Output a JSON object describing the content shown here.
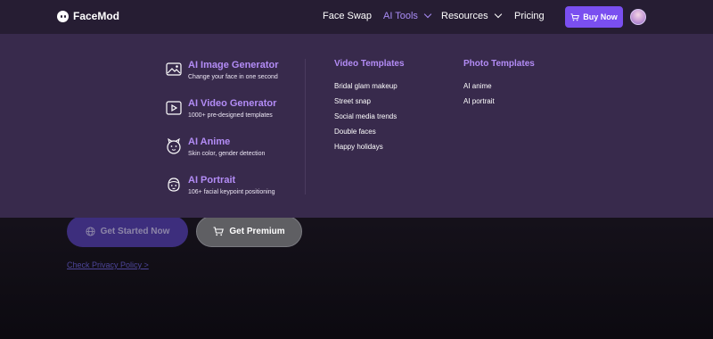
{
  "brand": {
    "name": "FaceMod"
  },
  "nav": {
    "face_swap": "Face Swap",
    "ai_tools": "AI Tools",
    "resources": "Resources",
    "pricing": "Pricing",
    "buy_now": "Buy Now"
  },
  "dropdown": {
    "tools": [
      {
        "title": "AI Image Generator",
        "subtitle": "Change your face in one second"
      },
      {
        "title": "AI Video Generator",
        "subtitle": "1000+ pre-designed templates"
      },
      {
        "title": "AI Anime",
        "subtitle": "Skin color, gender detection"
      },
      {
        "title": "AI Portrait",
        "subtitle": "106+ facial keypoint positioning"
      }
    ],
    "video_templates": {
      "title": "Video Templates",
      "items": [
        "Bridal glam makeup",
        "Street snap",
        "Social media trends",
        "Double faces",
        "Happy holidays"
      ]
    },
    "photo_templates": {
      "title": "Photo Templates",
      "items": [
        "AI anime",
        "AI portrait"
      ]
    }
  },
  "hero": {
    "get_started": "Get Started Now",
    "get_premium": "Get Premium",
    "privacy_link": "Check Privacy Policy >"
  },
  "colors": {
    "accent": "#7a4ff0",
    "menu_title": "#b38cf6",
    "dropdown_bg": "#382a4c",
    "navbar_bg": "#261d33"
  }
}
